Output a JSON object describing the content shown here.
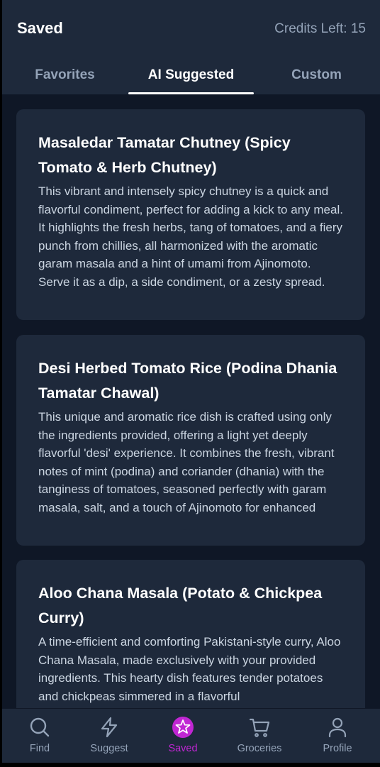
{
  "header": {
    "title": "Saved",
    "credits": "Credits Left: 15"
  },
  "tabs": [
    {
      "label": "Favorites",
      "active": false
    },
    {
      "label": "AI Suggested",
      "active": true
    },
    {
      "label": "Custom",
      "active": false
    }
  ],
  "recipes": [
    {
      "title": "Masaledar Tamatar Chutney (Spicy Tomato & Herb Chutney)",
      "description": "This vibrant and intensely spicy chutney is a quick and flavorful condiment, perfect for adding a kick to any meal. It highlights the fresh herbs, tang of tomatoes, and a fiery punch from chillies, all harmonized with the aromatic garam masala and a hint of umami from Ajinomoto. Serve it as a dip, a side condiment, or a zesty spread."
    },
    {
      "title": "Desi Herbed Tomato Rice (Podina Dhania Tamatar Chawal)",
      "description": "This unique and aromatic rice dish is crafted using only the ingredients provided, offering a light yet deeply flavorful 'desi' experience. It combines the fresh, vibrant notes of mint (podina) and coriander (dhania) with the tanginess of tomatoes, seasoned perfectly with garam masala, salt, and a touch of Ajinomoto for enhanced umami. Without the use of oil"
    },
    {
      "title": "Aloo Chana Masala (Potato & Chickpea Curry)",
      "description": "A time-efficient and comforting Pakistani-style curry, Aloo Chana Masala, made exclusively with your provided ingredients. This hearty dish features tender potatoes and chickpeas simmered in a flavorful"
    }
  ],
  "nav": [
    {
      "label": "Find",
      "icon": "search-icon",
      "active": false
    },
    {
      "label": "Suggest",
      "icon": "lightning-icon",
      "active": false
    },
    {
      "label": "Saved",
      "icon": "star-icon",
      "active": true
    },
    {
      "label": "Groceries",
      "icon": "cart-icon",
      "active": false
    },
    {
      "label": "Profile",
      "icon": "user-icon",
      "active": false
    }
  ],
  "colors": {
    "background": "#0f1726",
    "surface": "#1e293b",
    "accent": "#c026d3",
    "muted": "#94a3b8"
  }
}
